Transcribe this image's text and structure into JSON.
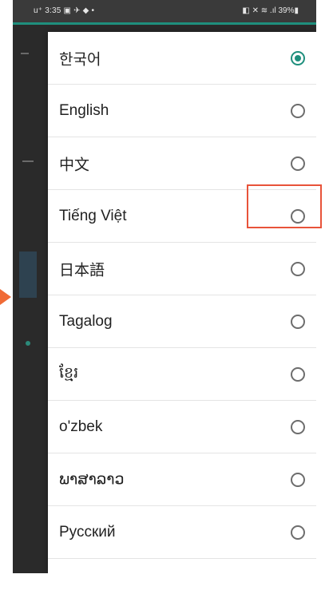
{
  "statusbar": {
    "left_text": "u⁺ 3:35 ▣ ✈ ◆ •",
    "right_text": "◧ ✕ ≋ .ıl 39%▮"
  },
  "dialog": {
    "items": [
      {
        "label": "한국어",
        "selected": true
      },
      {
        "label": "English",
        "selected": false
      },
      {
        "label": "中文",
        "selected": false
      },
      {
        "label": "Tiếng Việt",
        "selected": false
      },
      {
        "label": "日本語",
        "selected": false
      },
      {
        "label": "Tagalog",
        "selected": false
      },
      {
        "label": "ខ្មែរ",
        "selected": false
      },
      {
        "label": "o'zbek",
        "selected": false
      },
      {
        "label": "ພາສາລາວ",
        "selected": false
      },
      {
        "label": "Русский",
        "selected": false
      }
    ]
  },
  "colors": {
    "accent": "#1f8f7d",
    "highlight": "#e8533a",
    "arrow": "#f06b36"
  }
}
